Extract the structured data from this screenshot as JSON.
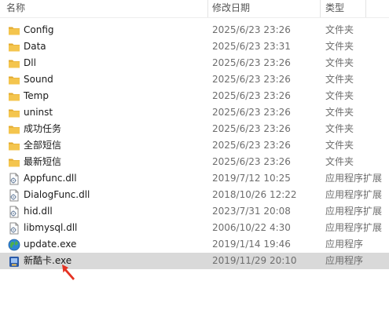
{
  "columns": {
    "name": "名称",
    "date": "修改日期",
    "type": "类型"
  },
  "colors": {
    "folder": "#f4c54e",
    "selected_row": "#d9d9d9",
    "annotation_arrow": "#e53222"
  },
  "files": [
    {
      "name": "Config",
      "date": "2025/6/23 23:26",
      "type": "文件夹",
      "icon": "folder-icon"
    },
    {
      "name": "Data",
      "date": "2025/6/23 23:31",
      "type": "文件夹",
      "icon": "folder-icon"
    },
    {
      "name": "Dll",
      "date": "2025/6/23 23:26",
      "type": "文件夹",
      "icon": "folder-icon"
    },
    {
      "name": "Sound",
      "date": "2025/6/23 23:26",
      "type": "文件夹",
      "icon": "folder-icon"
    },
    {
      "name": "Temp",
      "date": "2025/6/23 23:26",
      "type": "文件夹",
      "icon": "folder-icon"
    },
    {
      "name": "uninst",
      "date": "2025/6/23 23:26",
      "type": "文件夹",
      "icon": "folder-icon"
    },
    {
      "name": "成功任务",
      "date": "2025/6/23 23:26",
      "type": "文件夹",
      "icon": "folder-icon"
    },
    {
      "name": "全部短信",
      "date": "2025/6/23 23:26",
      "type": "文件夹",
      "icon": "folder-icon"
    },
    {
      "name": "最新短信",
      "date": "2025/6/23 23:26",
      "type": "文件夹",
      "icon": "folder-icon"
    },
    {
      "name": "Appfunc.dll",
      "date": "2019/7/12 10:25",
      "type": "应用程序扩展",
      "icon": "dll-file-icon"
    },
    {
      "name": "DialogFunc.dll",
      "date": "2018/10/26 12:22",
      "type": "应用程序扩展",
      "icon": "dll-file-icon"
    },
    {
      "name": "hid.dll",
      "date": "2023/7/31 20:08",
      "type": "应用程序扩展",
      "icon": "dll-file-icon"
    },
    {
      "name": "libmysql.dll",
      "date": "2006/10/22 4:30",
      "type": "应用程序扩展",
      "icon": "dll-file-icon"
    },
    {
      "name": "update.exe",
      "date": "2019/1/14 19:46",
      "type": "应用程序",
      "icon": "globe-exe-icon"
    },
    {
      "name": "新酷卡.exe",
      "date": "2019/11/29 20:10",
      "type": "应用程序",
      "icon": "app-exe-icon",
      "selected": true
    }
  ]
}
